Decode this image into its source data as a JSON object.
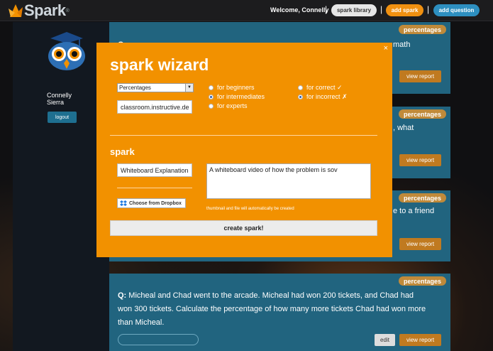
{
  "header": {
    "logo_text": "Spark",
    "logo_mark": "®",
    "welcome": "Welcome, Connelly",
    "separator": "|",
    "spark_library": "spark library",
    "add_spark": "add spark",
    "add_question": "add question"
  },
  "sidebar": {
    "user_first": "Connelly",
    "user_last": "Sierra",
    "logout": "logout"
  },
  "cards": [
    {
      "tag": "percentages",
      "text_left": "Q:",
      "text_right": "math",
      "view_report": "view report"
    },
    {
      "tag": "percentages",
      "text_right": ", what",
      "view_report": "view report"
    },
    {
      "tag": "percentages",
      "text_right": "e to a friend",
      "view_report": "view report"
    },
    {
      "tag": "percentages",
      "q_label": "Q:",
      "q_line1": "Micheal and Chad went to the arcade. Micheal had won 200 tickets, and Chad had",
      "q_line2": "won 300 tickets. Calculate the percentage of how many more tickets Chad had won more",
      "q_line3": "than Micheal.",
      "edit": "edit",
      "view_report": "view report"
    }
  ],
  "wizard": {
    "close": "×",
    "title": "spark wizard",
    "topic_selected": "Percentages",
    "url_value": "classroom.instructive.de",
    "levels": [
      {
        "label": "for beginners",
        "checked": false
      },
      {
        "label": "for intermediates",
        "checked": true
      },
      {
        "label": "for experts",
        "checked": false
      }
    ],
    "feedback": [
      {
        "label": "for correct ✓",
        "checked": false
      },
      {
        "label": "for incorrect ✗",
        "checked": true
      }
    ],
    "section_title": "spark",
    "spark_title_value": "Whiteboard Explanation",
    "description_value": "A whiteboard video of how the problem is sov",
    "dropbox_label": "Choose from Dropbox",
    "note": "thumbnail and file will automatically be created",
    "create_label": "create spark!"
  },
  "colors": {
    "accent_orange": "#f29100",
    "card_blue": "#21647f",
    "tag_orange": "#c08a3a",
    "button_blue": "#2d8fc0"
  }
}
